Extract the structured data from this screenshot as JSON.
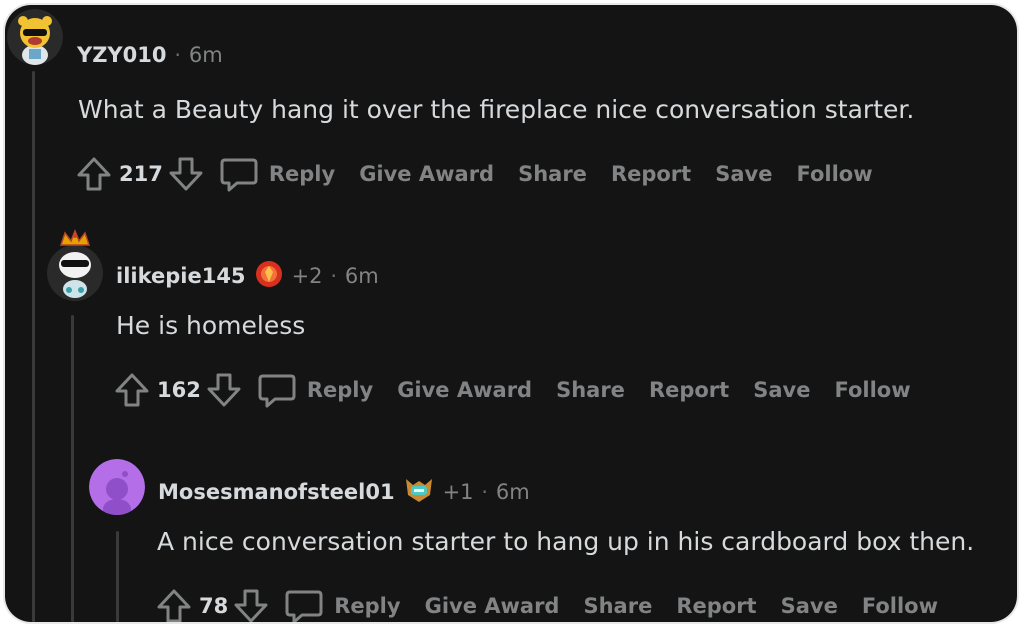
{
  "comments": [
    {
      "username": "YZY010",
      "time": "6m",
      "body": "What a Beauty hang it over the fireplace nice conversation starter.",
      "score": "217",
      "actions": {
        "reply": "Reply",
        "give_award": "Give Award",
        "share": "Share",
        "report": "Report",
        "save": "Save",
        "follow": "Follow"
      }
    },
    {
      "username": "ilikepie145",
      "award_count": "+2",
      "time": "6m",
      "body": "He is homeless",
      "score": "162",
      "actions": {
        "reply": "Reply",
        "give_award": "Give Award",
        "share": "Share",
        "report": "Report",
        "save": "Save",
        "follow": "Follow"
      }
    },
    {
      "username": "Mosesmanofsteel01",
      "award_count": "+1",
      "time": "6m",
      "body": "A nice conversation starter to hang up in his cardboard box then.",
      "score": "78",
      "actions": {
        "reply": "Reply",
        "give_award": "Give Award",
        "share": "Share",
        "report": "Report",
        "save": "Save",
        "follow": "Follow"
      }
    }
  ],
  "colors": {
    "background": "#141414",
    "text": "#d7dadc",
    "muted": "#818384",
    "thread_line": "#3a3a3a"
  }
}
